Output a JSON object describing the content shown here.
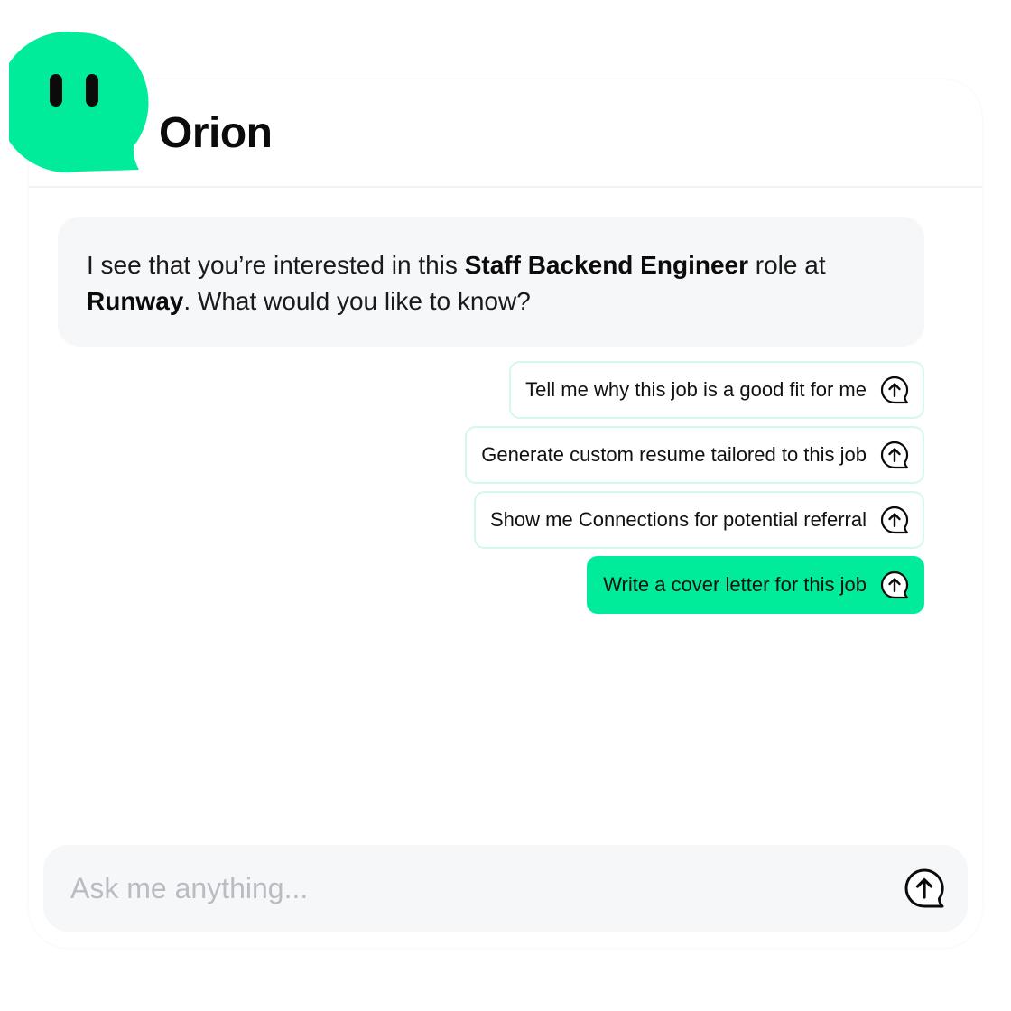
{
  "header": {
    "title": "Orion",
    "logo_icon": "speech-bubble-face-icon",
    "accent_color": "#00ec9a"
  },
  "message": {
    "part1": "I see that you’re interested in this ",
    "role": "Staff Backend Engineer",
    "part2": " role at ",
    "company": "Runway",
    "part3": ". What would you like to know?"
  },
  "suggestions": [
    {
      "label": "Tell me why this job is a good fit for me",
      "icon": "send-bubble-icon"
    },
    {
      "label": "Generate custom resume tailored to this job",
      "icon": "send-bubble-icon"
    },
    {
      "label": "Show me Connections for potential referral",
      "icon": "send-bubble-icon"
    },
    {
      "label": "Write a cover letter for this job",
      "icon": "send-bubble-icon",
      "selected": true
    }
  ],
  "input": {
    "placeholder": "Ask me anything...",
    "value": "",
    "send_icon": "send-bubble-icon"
  }
}
